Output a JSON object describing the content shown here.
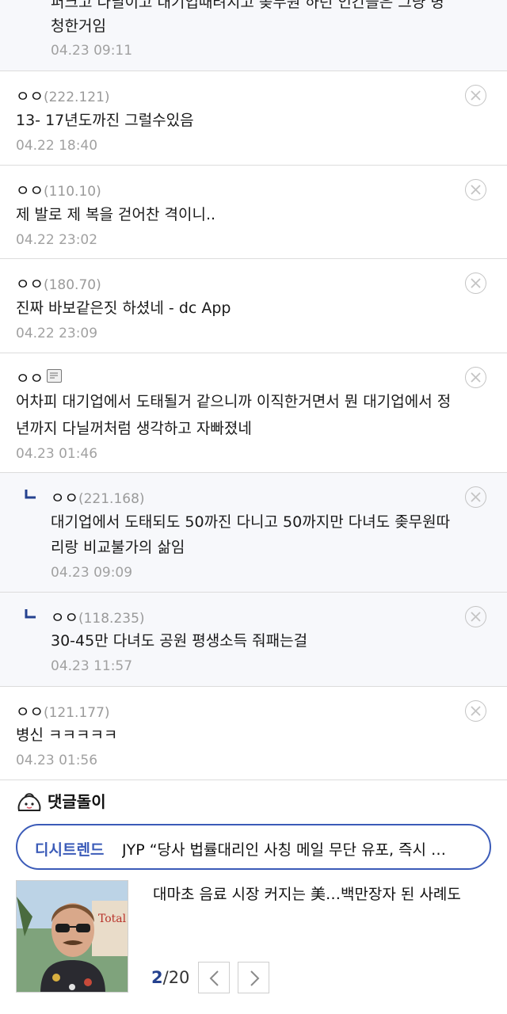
{
  "top_comment": {
    "line1": "퍼크고 다닐이고 대기업때려치고 좆무원 하던 인간들은 그냥 병",
    "line2": "청한거임",
    "date": "04.23 09:11"
  },
  "comments": [
    {
      "author": "ㅇㅇ",
      "ip": "(222.121)",
      "lines": [
        "13- 17년도까진 그럴수있음"
      ],
      "date": "04.22 18:40"
    },
    {
      "author": "ㅇㅇ",
      "ip": "(110.10)",
      "lines": [
        "제 발로 제 복을 걷어찬 격이니.."
      ],
      "date": "04.22 23:02"
    },
    {
      "author": "ㅇㅇ",
      "ip": "(180.70)",
      "lines": [
        "진짜 바보같은짓 하셨네 - dc App"
      ],
      "date": "04.22 23:09"
    },
    {
      "author": "ㅇㅇ",
      "ip": "",
      "lines": [
        "어차피 대기업에서 도태될거 같으니까 이직한거면서 뭔 대기업에서 정",
        "년까지 다닐꺼처럼 생각하고 자빠졌네"
      ],
      "date": "04.23 01:46"
    },
    {
      "author": "ㅇㅇ",
      "ip": "(221.168)",
      "lines": [
        "대기업에서 도태되도 50까진 다니고 50까지만 다녀도 좆무원따",
        "리랑 비교불가의 삶임"
      ],
      "date": "04.23 09:09"
    },
    {
      "author": "ㅇㅇ",
      "ip": "(118.235)",
      "lines": [
        "30-45만 다녀도 공원 평생소득 줘패는걸"
      ],
      "date": "04.23 11:57"
    },
    {
      "author": "ㅇㅇ",
      "ip": "(121.177)",
      "lines": [
        "병신 ㅋㅋㅋㅋㅋ"
      ],
      "date": "04.23 01:56"
    }
  ],
  "dol": {
    "title": "댓글돌이",
    "trend_label": "디시트렌드",
    "trend_headline": "JYP “당사 법률대리인 사칭 메일 무단 유포, 즉시 …"
  },
  "news": {
    "title": "대마초 음료 시장 커지는 美…백만장자 된 사례도",
    "page_current": "2",
    "page_total": "/20"
  }
}
